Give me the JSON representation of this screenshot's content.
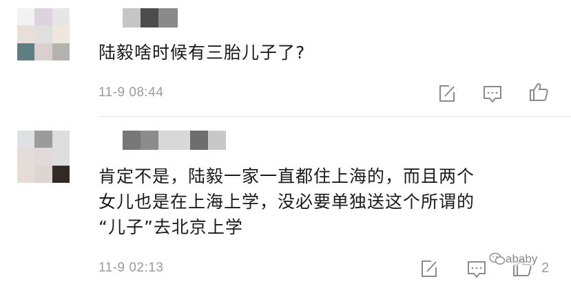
{
  "comments": [
    {
      "text": "陆毅啥时候有三胎儿子了?",
      "time": "11-9 08:44",
      "avatar_colors": [
        "#f2f2f2",
        "#ddd3de",
        "#e6e6e6",
        "#e8dfd8",
        "#dfe0de",
        "#efe7dc",
        "#5d7f84",
        "#d9cfcf",
        "#b4b2ae"
      ],
      "name_colors": [
        "#c6c6c6",
        "#4c4c4c",
        "#8a8a8a"
      ]
    },
    {
      "text": "肯定不是，陆毅一家一直都住上海的，而且两个\n女儿也是在上海上学，没必要单独送这个所谓的\n“儿子”去北京上学",
      "time": "11-9 02:13",
      "like_count": "2",
      "avatar_colors": [
        "#dfe0e2",
        "#9b9b9b",
        "#dddddd",
        "#e4dcd8",
        "#e2dada",
        "#dedede",
        "#e6dcd5",
        "#dcd5d2",
        "#332a28"
      ],
      "name_colors": [
        "#777777",
        "#8c8c8c",
        "#d8d8d8",
        "#6e6e6e",
        "#c8c8c8"
      ]
    }
  ],
  "watermark": "ababy",
  "icons": [
    "edit-icon",
    "reply-icon",
    "like-icon",
    "wechat-logo-icon"
  ]
}
